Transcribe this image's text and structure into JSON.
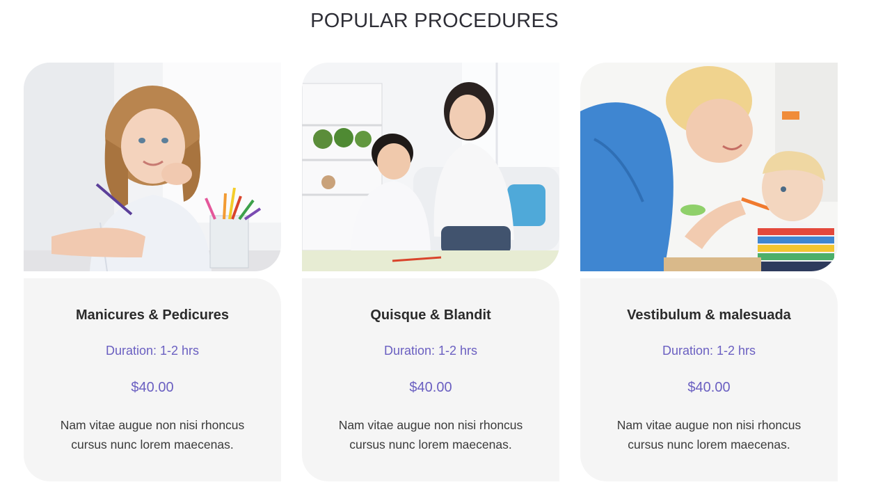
{
  "section": {
    "title": "POPULAR PROCEDURES"
  },
  "colors": {
    "accent": "#6a5fc1",
    "card_bg": "#f5f5f5",
    "text": "#2b2b2b"
  },
  "procedures": [
    {
      "title": "Manicures & Pedicures",
      "duration": "Duration: 1-2 hrs",
      "price": "$40.00",
      "description": "Nam vitae augue non nisi rhoncus cursus nunc lorem maecenas."
    },
    {
      "title": "Quisque & Blandit",
      "duration": "Duration: 1-2 hrs",
      "price": "$40.00",
      "description": "Nam vitae augue non nisi rhoncus cursus nunc lorem maecenas."
    },
    {
      "title": "Vestibulum & malesuada",
      "duration": "Duration: 1-2 hrs",
      "price": "$40.00",
      "description": "Nam vitae augue non nisi rhoncus cursus nunc lorem maecenas."
    }
  ]
}
